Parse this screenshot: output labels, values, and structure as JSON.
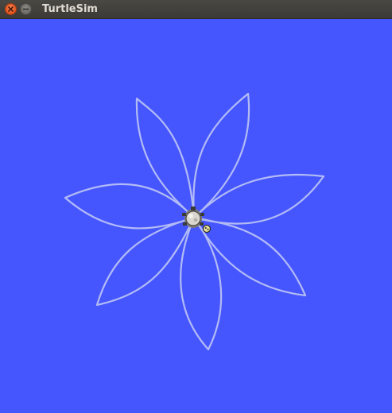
{
  "window": {
    "title": "TurtleSim",
    "close_icon": "close-icon",
    "minimize_icon": "minimize-icon"
  },
  "canvas": {
    "background_color": "#4556ff",
    "pen_color": "#b3bbf5",
    "turtle_icon": "turtle-icon"
  }
}
